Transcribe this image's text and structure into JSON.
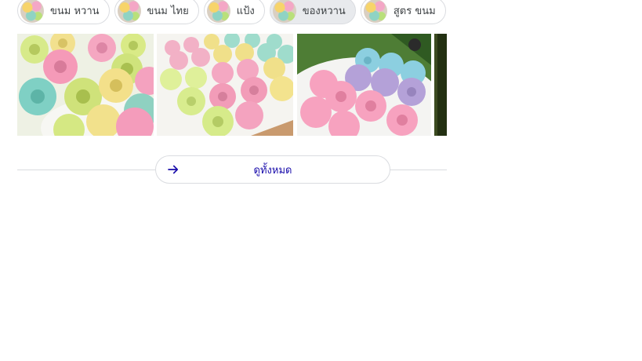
{
  "chips": [
    {
      "label": "ขนม หวาน",
      "icon": "thumbnail-image"
    },
    {
      "label": "ขนม ไทย",
      "icon": "thumbnail-image"
    },
    {
      "label": "แป้ง",
      "icon": "thumbnail-image"
    },
    {
      "label": "ของหวาน",
      "icon": "thumbnail-image",
      "active": true
    },
    {
      "label": "สูตร ขนม",
      "icon": "thumbnail-image"
    }
  ],
  "images": [
    {
      "subject": "colorful ring-shaped Thai desserts on a plate"
    },
    {
      "subject": "rows of pastel ring-shaped desserts on a board"
    },
    {
      "subject": "pink, purple and blue ring desserts on banana leaf"
    },
    {
      "subject": "partially visible image"
    }
  ],
  "see_all": {
    "label": "ดูทั้งหมด",
    "icon": "arrow-right-icon"
  },
  "colors": {
    "link": "#1a0dab",
    "border": "#dadce0",
    "chip_active_bg": "#e8eaed"
  }
}
